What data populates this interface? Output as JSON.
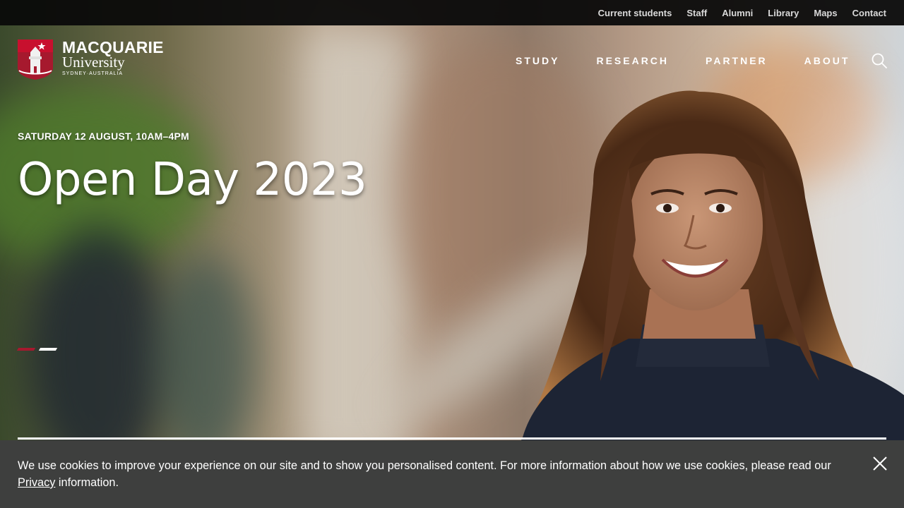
{
  "utility_nav": [
    "Current students",
    "Staff",
    "Alumni",
    "Library",
    "Maps",
    "Contact"
  ],
  "logo": {
    "title": "MACQUARIE",
    "subtitle": "University",
    "tagline": "SYDNEY·AUSTRALIA"
  },
  "main_nav": [
    "STUDY",
    "RESEARCH",
    "PARTNER",
    "ABOUT"
  ],
  "search": {
    "icon": "search-icon"
  },
  "hero": {
    "eyebrow": "SATURDAY 12 AUGUST, 10AM–4PM",
    "headline": "Open Day 2023",
    "slides": {
      "count": 2,
      "active": 0
    }
  },
  "cookie_banner": {
    "text_before": "We use cookies to improve your experience on our site and to show you personalised content. For more information about how we use cookies, please read our ",
    "link_label": "Privacy",
    "text_after": " information.",
    "close_icon": "close-icon"
  },
  "colors": {
    "brand_red": "#a6192e",
    "utility_bar": "#0a0a0a",
    "cookie_bg": "#3e3f3e"
  }
}
